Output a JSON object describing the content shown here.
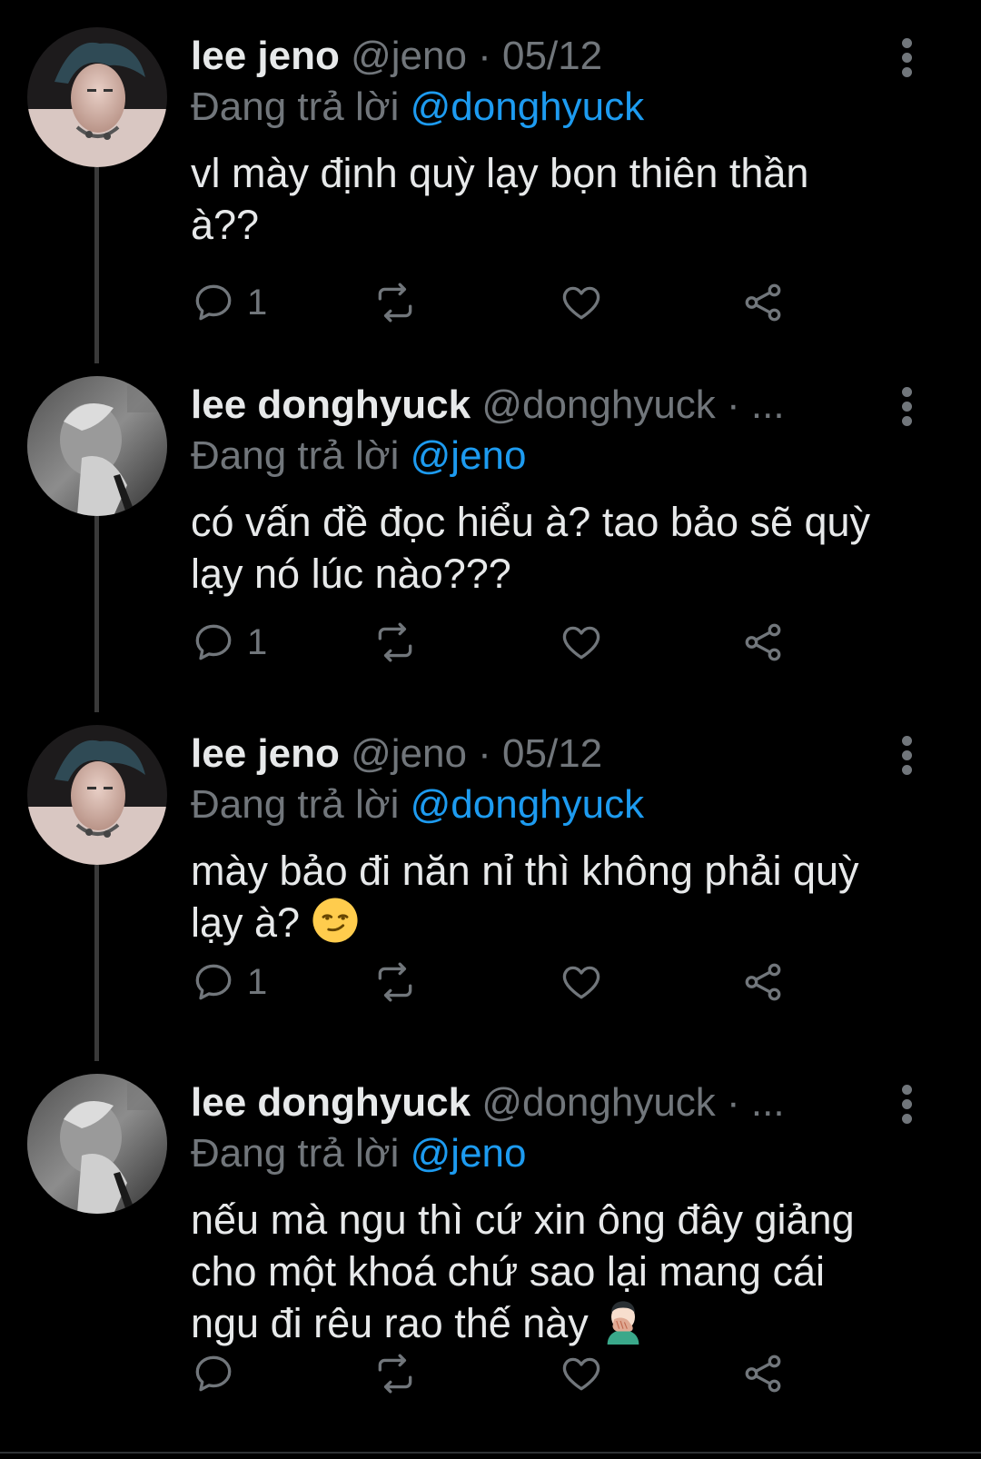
{
  "colors": {
    "background": "#000000",
    "primary_text": "#e7e9ea",
    "secondary_text": "#71767b",
    "accent": "#1d9bf0",
    "thread_line": "#3a3a3a"
  },
  "tweets": [
    {
      "display_name": "lee jeno",
      "handle": "@jeno",
      "separator": " · ",
      "date": "05/12",
      "reply_prefix": "Đang trả lời ",
      "reply_to": "@donghyuck",
      "text": "vl mày định quỳ lạy bọn thiên thần\nà??",
      "emoji": "",
      "reply_count": "1",
      "avatar_icon": "avatar-photo-jeno"
    },
    {
      "display_name": "lee donghyuck",
      "handle": "@donghyuck",
      "separator": " · ",
      "date": "...",
      "reply_prefix": "Đang trả lời ",
      "reply_to": "@jeno",
      "text": "có vấn đề đọc hiểu à? tao bảo sẽ quỳ\nlạy nó lúc nào???",
      "emoji": "",
      "reply_count": "1",
      "avatar_icon": "avatar-photo-donghyuck"
    },
    {
      "display_name": "lee jeno",
      "handle": "@jeno",
      "separator": " · ",
      "date": "05/12",
      "reply_prefix": "Đang trả lời ",
      "reply_to": "@donghyuck",
      "text": "mày bảo đi năn nỉ thì không phải quỳ\nlạy à? ",
      "emoji": "smirking-face-emoji",
      "reply_count": "1",
      "avatar_icon": "avatar-photo-jeno"
    },
    {
      "display_name": "lee donghyuck",
      "handle": "@donghyuck",
      "separator": " · ",
      "date": "...",
      "reply_prefix": "Đang trả lời ",
      "reply_to": "@jeno",
      "text": "nếu mà ngu thì cứ xin ông đây giảng\ncho một khoá chứ sao lại mang cái\nngu đi rêu rao thế này ",
      "emoji": "facepalm-emoji",
      "reply_count": "",
      "avatar_icon": "avatar-photo-donghyuck"
    }
  ],
  "icons": {
    "reply": "reply-bubble-icon",
    "retweet": "retweet-icon",
    "like": "heart-icon",
    "share": "share-icon",
    "menu": "more-vertical-icon"
  }
}
